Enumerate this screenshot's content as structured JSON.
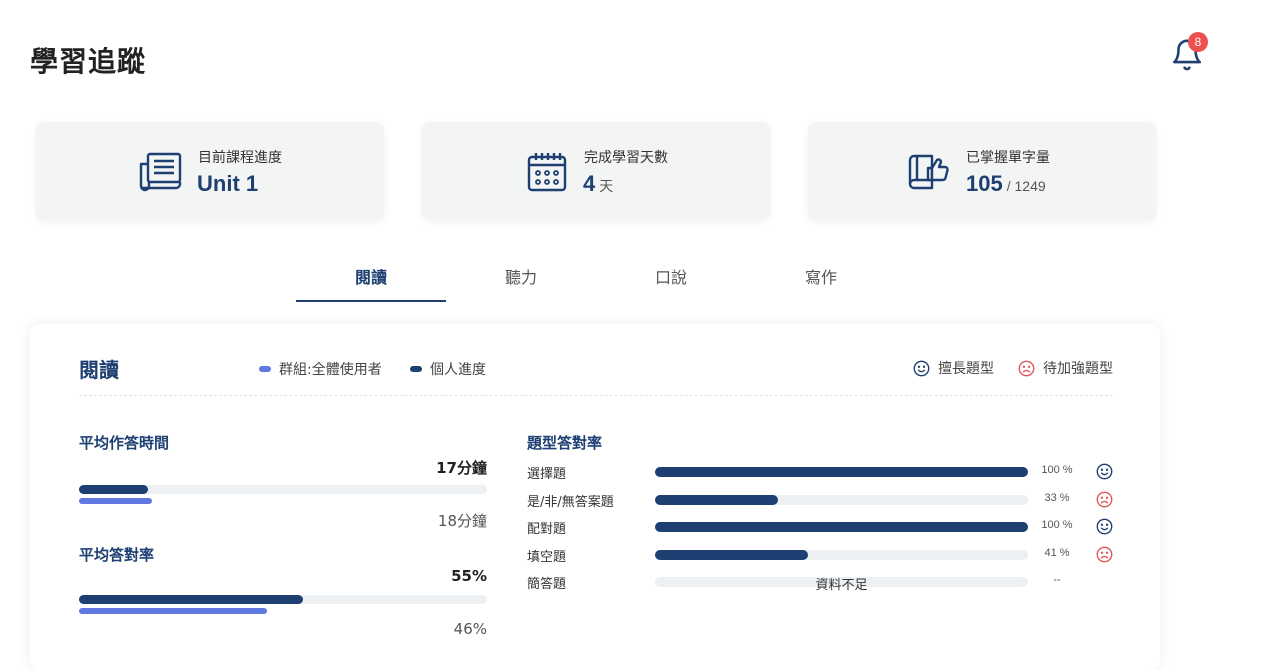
{
  "header": {
    "title": "學習追蹤",
    "notification_count": "8"
  },
  "stats": [
    {
      "icon": "newspaper-icon",
      "label": "目前課程進度",
      "value": "Unit 1"
    },
    {
      "icon": "calendar-icon",
      "label": "完成學習天數",
      "value": "4",
      "unit": "天"
    },
    {
      "icon": "thumbs-up-book-icon",
      "label": "已掌握單字量",
      "value": "105",
      "total": "/  1249"
    }
  ],
  "tabs": [
    {
      "label": "閱讀",
      "active": true
    },
    {
      "label": "聽力",
      "active": false
    },
    {
      "label": "口說",
      "active": false
    },
    {
      "label": "寫作",
      "active": false
    }
  ],
  "panel": {
    "title": "閱讀",
    "legend": {
      "group": {
        "label": "群組:全體使用者",
        "color": "#6079e0"
      },
      "personal": {
        "label": "個人進度",
        "color": "#1d3f72"
      }
    },
    "face_legend": {
      "good": {
        "label": "擅長題型",
        "icon": "smile-icon",
        "color": "#1d3f72"
      },
      "weak": {
        "label": "待加強題型",
        "icon": "frown-icon",
        "color": "#e05555"
      }
    },
    "metrics": [
      {
        "title": "平均作答時間",
        "mine_label": "17分鐘",
        "group_label": "18分鐘",
        "mine_fraction": 0.17,
        "group_fraction": 0.18
      },
      {
        "title": "平均答對率",
        "mine_label": "55%",
        "group_label": "46%",
        "mine_fraction": 0.55,
        "group_fraction": 0.46
      }
    ],
    "question_types": {
      "title": "題型答對率",
      "rows": [
        {
          "name": "選擇題",
          "percent": 100,
          "percent_label": "100 %",
          "status": "good"
        },
        {
          "name": "是/非/無答案題",
          "percent": 33,
          "percent_label": "33 %",
          "status": "weak"
        },
        {
          "name": "配對題",
          "percent": 100,
          "percent_label": "100 %",
          "status": "good"
        },
        {
          "name": "填空題",
          "percent": 41,
          "percent_label": "41 %",
          "status": "weak"
        },
        {
          "name": "簡答題",
          "percent": null,
          "note": "資料不足",
          "percent_label": "--",
          "status": "none"
        }
      ]
    }
  }
}
